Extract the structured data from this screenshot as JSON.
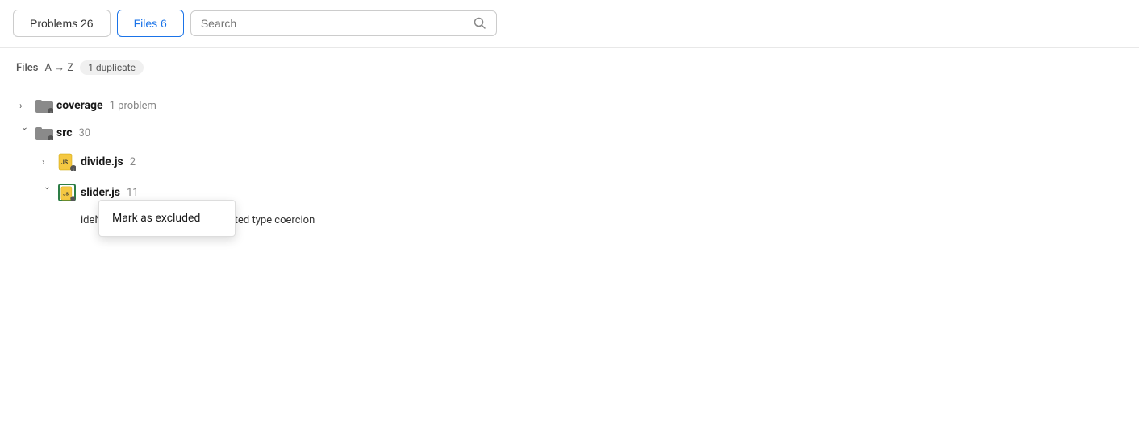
{
  "tabs": [
    {
      "id": "problems",
      "label": "Problems 26",
      "active": false
    },
    {
      "id": "files",
      "label": "Files 6",
      "active": true
    }
  ],
  "search": {
    "placeholder": "Search"
  },
  "sort": {
    "label": "Files",
    "direction": "A → Z",
    "badge": "1 duplicate"
  },
  "tree": {
    "items": [
      {
        "id": "coverage",
        "name": "coverage",
        "type": "folder",
        "expanded": false,
        "count": "1 problem",
        "indent": 0
      },
      {
        "id": "src",
        "name": "src",
        "type": "folder",
        "expanded": true,
        "count": "30",
        "indent": 0
      },
      {
        "id": "divide-js",
        "name": "divide.js",
        "type": "js-file",
        "expanded": false,
        "count": "2",
        "indent": 1
      },
      {
        "id": "slider-js",
        "name": "slider.js",
        "type": "js-file",
        "expanded": true,
        "count": "11",
        "indent": 1,
        "highlighted": true
      }
    ]
  },
  "context_menu": {
    "items": [
      {
        "label": "Mark as excluded"
      }
    ]
  },
  "problem_text": "ideNum == 0 may cause unexpected type coercion"
}
